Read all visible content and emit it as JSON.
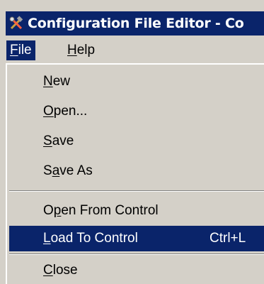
{
  "window": {
    "title": "Configuration File Editor - Co"
  },
  "menubar": {
    "items": [
      {
        "label": "File",
        "mnemonic": "F",
        "rest": "ile",
        "open": true
      },
      {
        "label": "Help",
        "mnemonic": "H",
        "rest": "elp",
        "open": false
      }
    ]
  },
  "file_menu": {
    "items": [
      {
        "label": "New",
        "pre": "",
        "mnemonic": "N",
        "post": "ew",
        "accel": ""
      },
      {
        "label": "Open...",
        "pre": "",
        "mnemonic": "O",
        "post": "pen...",
        "accel": ""
      },
      {
        "label": "Save",
        "pre": "",
        "mnemonic": "S",
        "post": "ave",
        "accel": ""
      },
      {
        "label": "Save As",
        "pre": "S",
        "mnemonic": "a",
        "post": "ve As",
        "accel": ""
      },
      {
        "label": "Open From Control",
        "pre": "O",
        "mnemonic": "p",
        "post": "en From Control",
        "accel": ""
      },
      {
        "label": "Load To Control",
        "pre": "",
        "mnemonic": "L",
        "post": "oad To Control",
        "accel": "Ctrl+L",
        "highlighted": true
      },
      {
        "label": "Close",
        "pre": "",
        "mnemonic": "C",
        "post": "lose",
        "accel": ""
      }
    ]
  },
  "colors": {
    "titlebar": "#0a246a",
    "menu_face": "#d4d0c8",
    "highlight": "#0a246a",
    "highlight_text": "#ffffff"
  },
  "icons": {
    "app": "tools-icon"
  }
}
